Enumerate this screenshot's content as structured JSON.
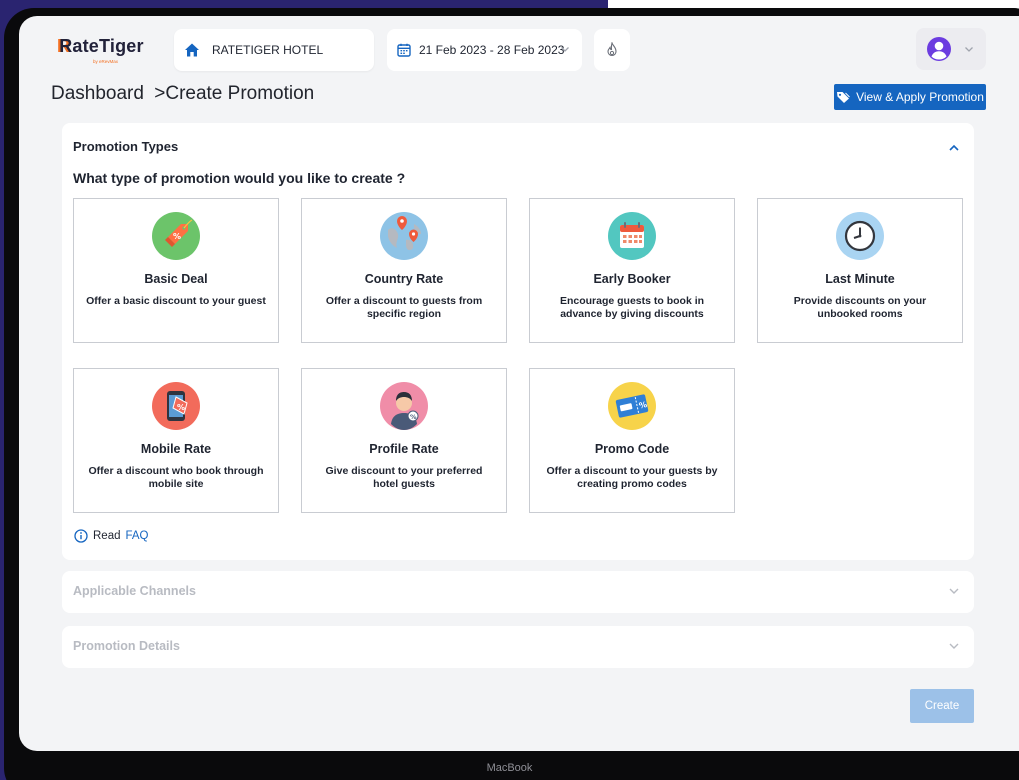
{
  "app": {
    "logo_text": "RateTiger",
    "logo_sub": "by eRevMax"
  },
  "header": {
    "hotel_name": "RATETIGER HOTEL",
    "date_range": "21 Feb 2023 - 28 Feb 2023"
  },
  "breadcrumb": {
    "root": "Dashboard",
    "separator": ">",
    "current": "Create Promotion"
  },
  "actions": {
    "view_apply_label": "View & Apply Promotion",
    "create_label": "Create"
  },
  "promotion_types": {
    "section_title": "Promotion Types",
    "question": "What type of promotion would you like to create ?",
    "items": [
      {
        "title": "Basic Deal",
        "description": "Offer a basic discount to your guest",
        "icon": "price-tag-icon"
      },
      {
        "title": "Country Rate",
        "description": "Offer a discount to guests from specific region",
        "icon": "globe-pin-icon"
      },
      {
        "title": "Early Booker",
        "description": "Encourage guests to book in advance by giving discounts",
        "icon": "calendar-icon"
      },
      {
        "title": "Last Minute",
        "description": "Provide discounts on your unbooked rooms",
        "icon": "clock-icon"
      },
      {
        "title": "Mobile Rate",
        "description": "Offer a discount who book through mobile site",
        "icon": "mobile-discount-icon"
      },
      {
        "title": "Profile Rate",
        "description": "Give discount to your preferred hotel guests",
        "icon": "guest-profile-icon"
      },
      {
        "title": "Promo Code",
        "description": "Offer a discount to your guests by creating promo codes",
        "icon": "promo-ticket-icon"
      }
    ],
    "faq_prefix": "Read",
    "faq_link": "FAQ"
  },
  "sections": {
    "applicable_channels": "Applicable Channels",
    "promotion_details": "Promotion Details"
  },
  "device": {
    "label": "MacBook"
  },
  "colors": {
    "accent_blue": "#1565c0",
    "create_disabled": "#9cc1e8",
    "brand_orange": "#f36f21",
    "avatar_purple": "#6c3ce0"
  }
}
